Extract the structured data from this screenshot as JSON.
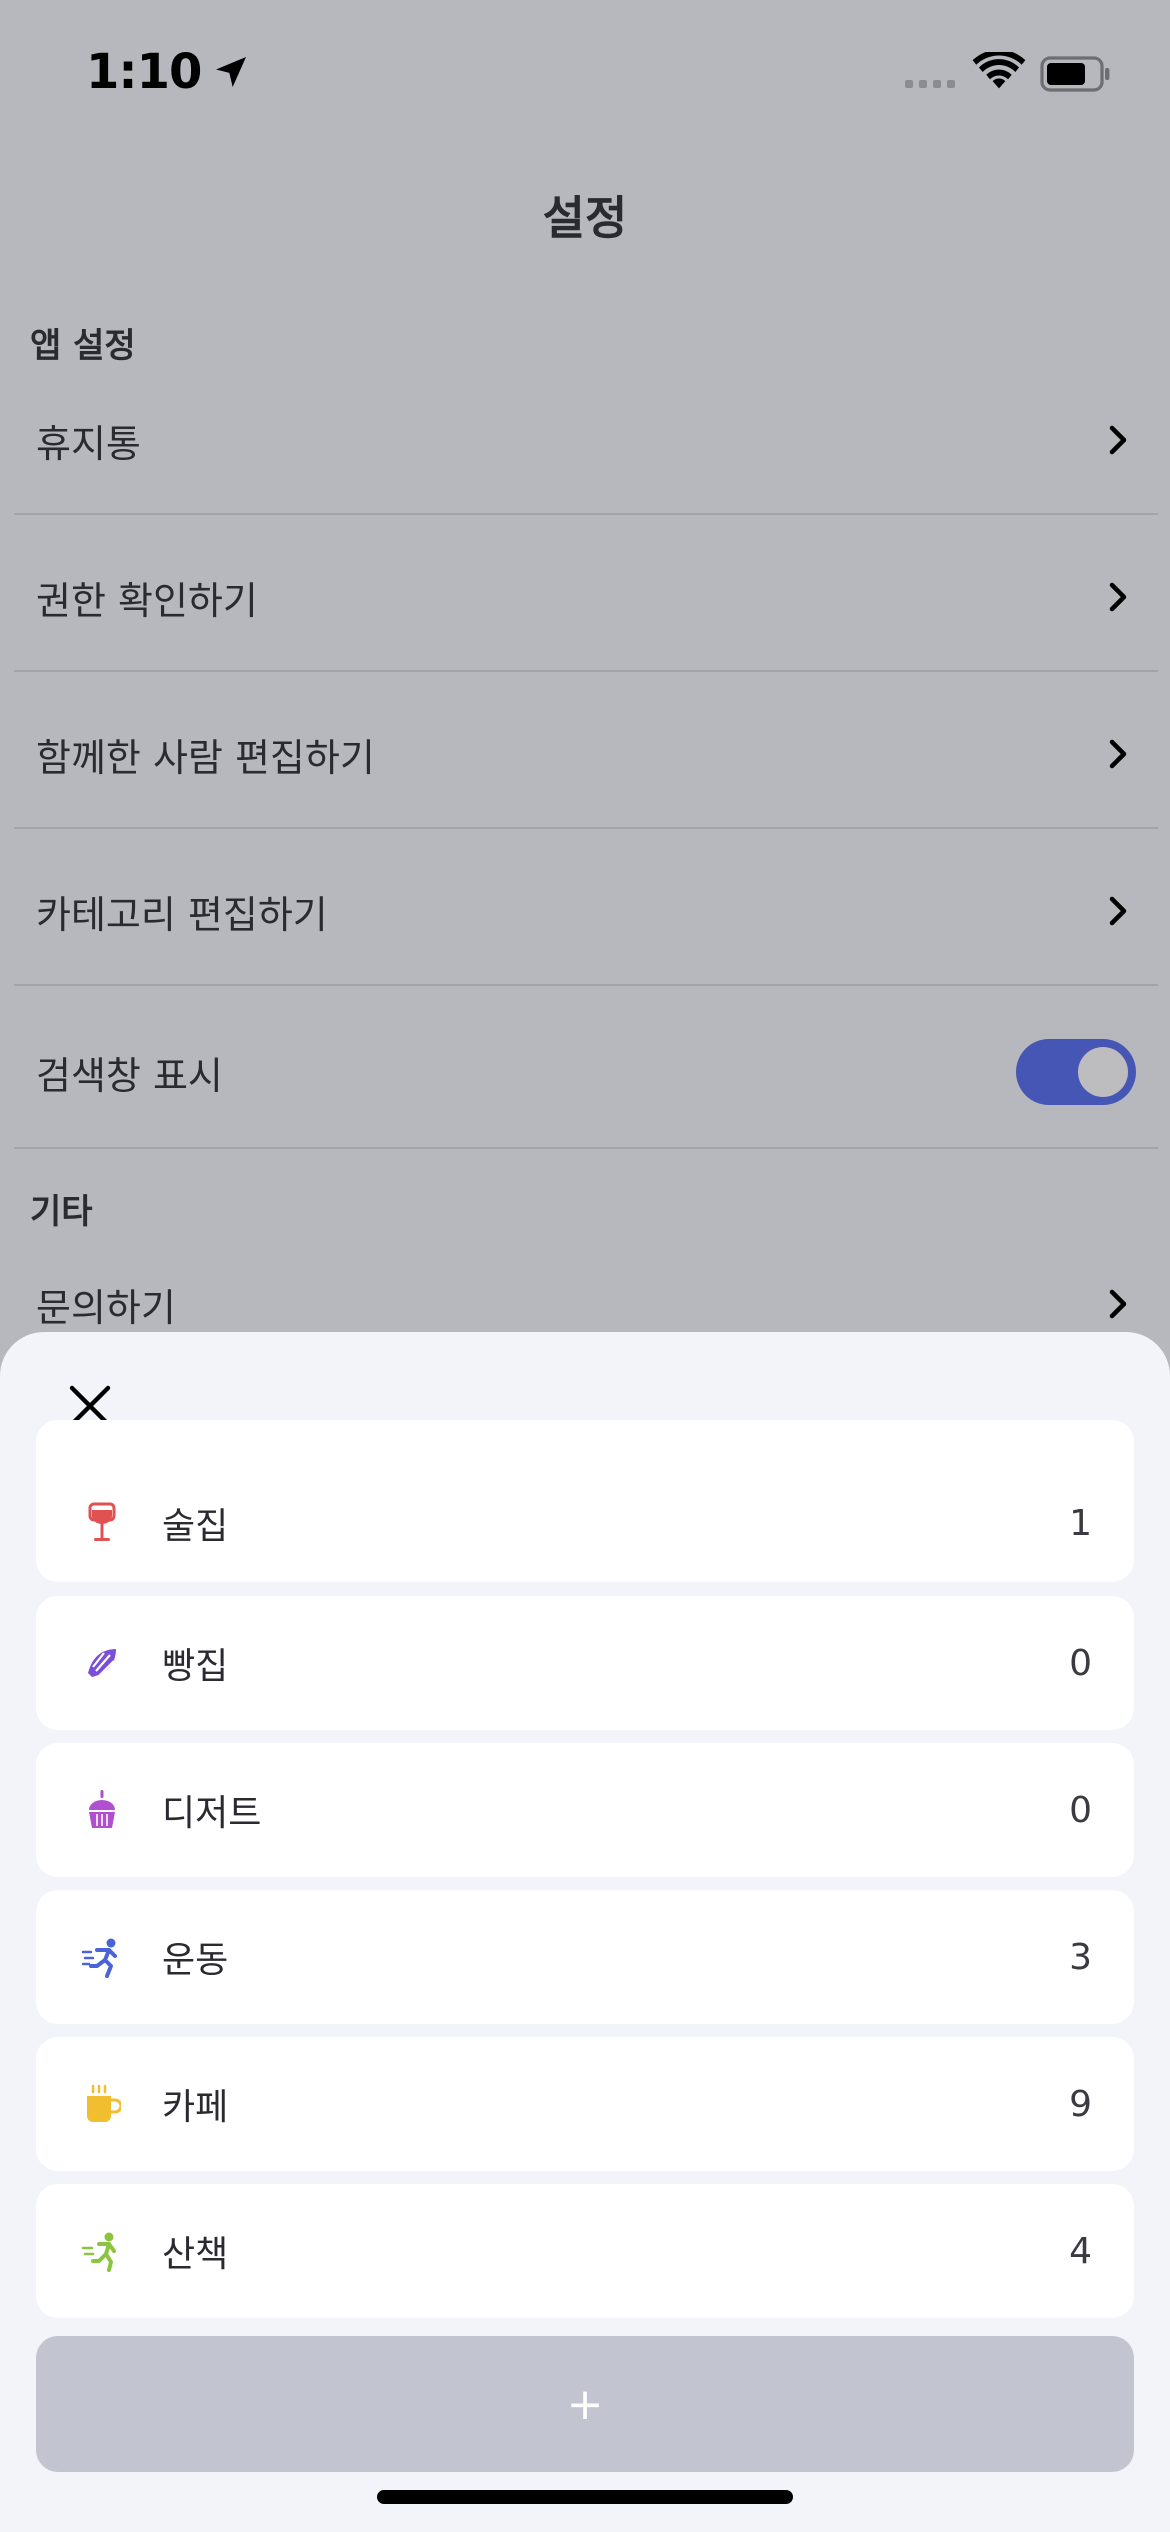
{
  "status": {
    "time": "1:10"
  },
  "page": {
    "title": "설정",
    "sections": {
      "app": "앱 설정",
      "etc": "기타"
    },
    "rows": {
      "trash": "휴지통",
      "permissions": "권한 확인하기",
      "people": "함께한 사람 편집하기",
      "categories": "카테고리 편집하기",
      "search": "검색창 표시",
      "contact": "문의하기"
    },
    "search_toggle_on": true
  },
  "sheet": {
    "categories": [
      {
        "icon": "wine-glass-icon",
        "name": "술집",
        "count": "1"
      },
      {
        "icon": "croissant-icon",
        "name": "빵집",
        "count": "0"
      },
      {
        "icon": "cupcake-icon",
        "name": "디저트",
        "count": "0"
      },
      {
        "icon": "runner-icon",
        "name": "운동",
        "count": "3"
      },
      {
        "icon": "coffee-cup-icon",
        "name": "카페",
        "count": "9"
      },
      {
        "icon": "walker-icon",
        "name": "산책",
        "count": "4"
      }
    ],
    "add_label": "+"
  },
  "colors": {
    "accent": "#4656b4",
    "wine": "#e05252",
    "croissant": "#7b4ed6",
    "cupcake": "#b04fd0",
    "run": "#4b63d8",
    "cafe": "#f0be2e",
    "walk": "#8bc53f"
  }
}
